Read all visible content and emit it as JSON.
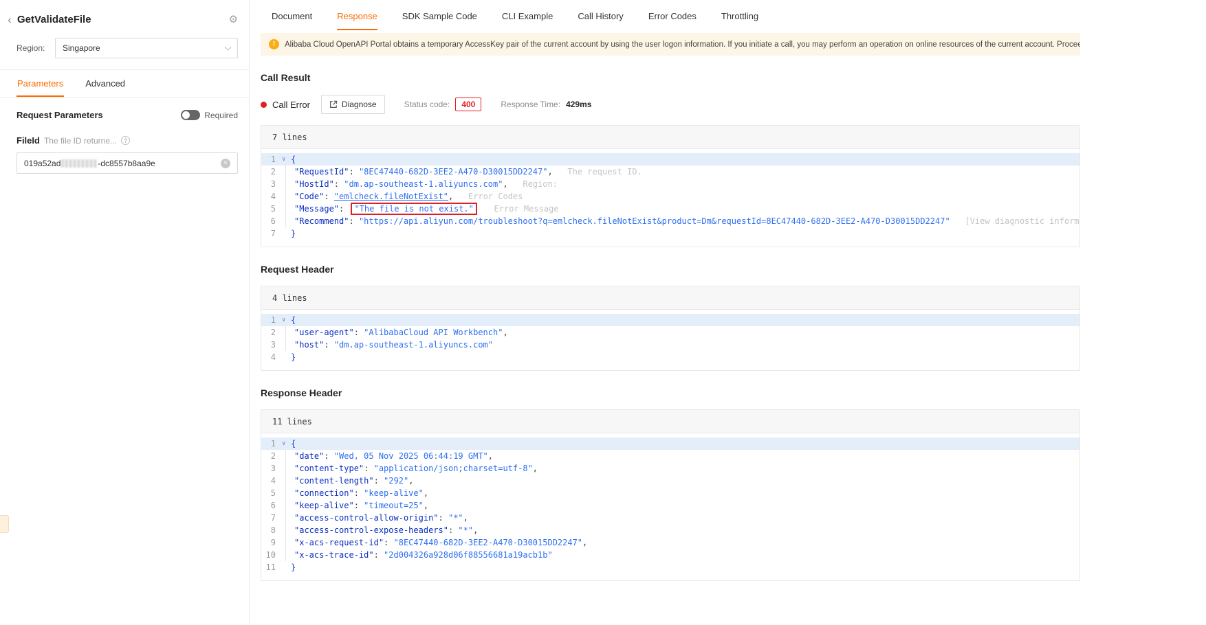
{
  "colors": {
    "accent": "#ff6a00",
    "error": "#e02020",
    "warning_bg": "#fdf6e6",
    "warning_icon": "#faad14"
  },
  "sidebar": {
    "title": "GetValidateFile",
    "region": {
      "label": "Region:",
      "value": "Singapore"
    },
    "tabs": [
      {
        "label": "Parameters"
      },
      {
        "label": "Advanced"
      }
    ],
    "request_parameters": {
      "title": "Request Parameters",
      "toggle_label": "Required"
    },
    "field": {
      "name": "FileId",
      "hint": "The file ID returne...",
      "value_prefix": "019a52ad",
      "value_suffix": "-dc8557b8aa9e"
    }
  },
  "main": {
    "tabs": [
      {
        "label": "Document"
      },
      {
        "label": "Response",
        "active": true
      },
      {
        "label": "SDK Sample Code"
      },
      {
        "label": "CLI Example"
      },
      {
        "label": "Call History"
      },
      {
        "label": "Error Codes"
      },
      {
        "label": "Throttling"
      }
    ],
    "warning": "Alibaba Cloud OpenAPI Portal obtains a temporary AccessKey pair of the current account by using the user logon information. If you initiate a call, you may perform an operation on online resources of the current account. Proceed with caution.",
    "call_result": {
      "title": "Call Result",
      "error_label": "Call Error",
      "diagnose_label": "Diagnose",
      "status_label": "Status code:",
      "status_code": "400",
      "time_label": "Response Time:",
      "time_value": "429ms"
    },
    "sections": {
      "request_header": "Request Header",
      "response_header": "Response Header"
    },
    "result_block": {
      "label": "7 lines",
      "lines": [
        {
          "n": 1,
          "type": "open"
        },
        {
          "n": 2,
          "key": "\"RequestId\"",
          "val": "\"8EC47440-682D-3EE2-A470-D30015DD2247\"",
          "comma": true,
          "comment": "The request ID."
        },
        {
          "n": 3,
          "key": "\"HostId\"",
          "val": "\"dm.ap-southeast-1.aliyuncs.com\"",
          "comma": true,
          "comment": "Region:"
        },
        {
          "n": 4,
          "key": "\"Code\"",
          "val": "\"emlcheck.fileNotExist\"",
          "comma": true,
          "underline": true,
          "comment": "Error Codes"
        },
        {
          "n": 5,
          "key": "\"Message\"",
          "val": "\"The file is not exist.\"",
          "boxed": true,
          "comment": "Error Message"
        },
        {
          "n": 6,
          "key": "\"Recommend\"",
          "val": "\"https://api.aliyun.com/troubleshoot?q=emlcheck.fileNotExist&product=Dm&requestId=8EC47440-682D-3EE2-A470-D30015DD2247\"",
          "comment": "[View diagnostic information](https://api.aliyun.com/trouble"
        },
        {
          "n": 7,
          "type": "close"
        }
      ]
    },
    "request_block": {
      "label": "4 lines",
      "lines": [
        {
          "n": 1,
          "type": "open"
        },
        {
          "n": 2,
          "key": "\"user-agent\"",
          "val": "\"AlibabaCloud API Workbench\"",
          "comma": true
        },
        {
          "n": 3,
          "key": "\"host\"",
          "val": "\"dm.ap-southeast-1.aliyuncs.com\""
        },
        {
          "n": 4,
          "type": "close"
        }
      ]
    },
    "response_block": {
      "label": "11 lines",
      "lines": [
        {
          "n": 1,
          "type": "open"
        },
        {
          "n": 2,
          "key": "\"date\"",
          "val": "\"Wed, 05 Nov 2025 06:44:19 GMT\"",
          "comma": true
        },
        {
          "n": 3,
          "key": "\"content-type\"",
          "val": "\"application/json;charset=utf-8\"",
          "comma": true
        },
        {
          "n": 4,
          "key": "\"content-length\"",
          "val": "\"292\"",
          "comma": true
        },
        {
          "n": 5,
          "key": "\"connection\"",
          "val": "\"keep-alive\"",
          "comma": true
        },
        {
          "n": 6,
          "key": "\"keep-alive\"",
          "val": "\"timeout=25\"",
          "comma": true
        },
        {
          "n": 7,
          "key": "\"access-control-allow-origin\"",
          "val": "\"*\"",
          "comma": true
        },
        {
          "n": 8,
          "key": "\"access-control-expose-headers\"",
          "val": "\"*\"",
          "comma": true
        },
        {
          "n": 9,
          "key": "\"x-acs-request-id\"",
          "val": "\"8EC47440-682D-3EE2-A470-D30015DD2247\"",
          "comma": true
        },
        {
          "n": 10,
          "key": "\"x-acs-trace-id\"",
          "val": "\"2d004326a928d06f88556681a19acb1b\""
        },
        {
          "n": 11,
          "type": "close"
        }
      ]
    }
  }
}
